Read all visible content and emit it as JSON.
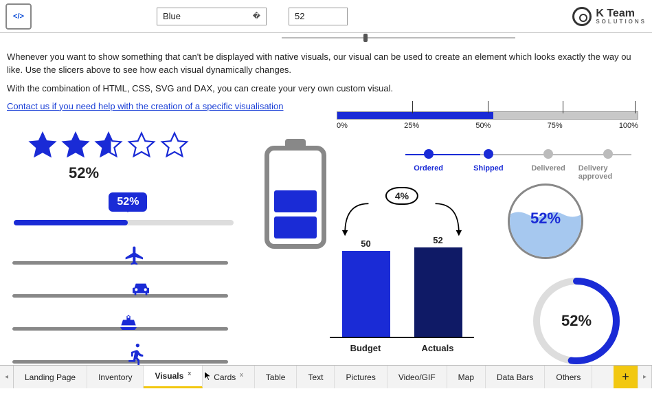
{
  "header": {
    "dropdown_value": "Blue",
    "number_value": "52",
    "logo_main": "K Team",
    "logo_sub": "SOLUTIONS"
  },
  "intro": {
    "p1": "Whenever you want to show something that can't be displayed with native visuals, our visual can be used to create an element which looks exactly the way ou like. Use the slicers above to see how each visual dynamically changes.",
    "p2": "With the combination of HTML, CSS, SVG and DAX, you can create your very own custom visual.",
    "link": "Contact us if you need help with the creation of a specific visualisation"
  },
  "stars": {
    "pct_label": "52%"
  },
  "bubble": {
    "label": "52%",
    "fill_pct": 52
  },
  "slider_icons": {
    "positions": [
      55,
      58,
      52,
      56
    ]
  },
  "pctbar": {
    "fill": 52,
    "ticks": [
      "0%",
      "25%",
      "50%",
      "75%",
      "100%"
    ]
  },
  "steps": {
    "items": [
      {
        "label": "Ordered",
        "active": true
      },
      {
        "label": "Shipped",
        "active": true
      },
      {
        "label": "Delivered",
        "active": false
      },
      {
        "label": "Delivery approved",
        "active": false
      }
    ],
    "progress_pct": 33
  },
  "water": {
    "label": "52%",
    "fill": 52
  },
  "arc": {
    "label": "52%",
    "pct": 52
  },
  "tabs": {
    "items": [
      "Landing Page",
      "Inventory",
      "Visuals",
      "Cards",
      "Table",
      "Text",
      "Pictures",
      "Video/GIF",
      "Map",
      "Data Bars",
      "Others"
    ],
    "active_index": 2,
    "closable": [
      2,
      3
    ]
  },
  "colors": {
    "accent": "#1a2bd6"
  },
  "chart_data": {
    "type": "bar",
    "categories": [
      "Budget",
      "Actuals"
    ],
    "values": [
      50,
      52
    ],
    "diff_label": "4%",
    "ylim": [
      0,
      60
    ]
  }
}
